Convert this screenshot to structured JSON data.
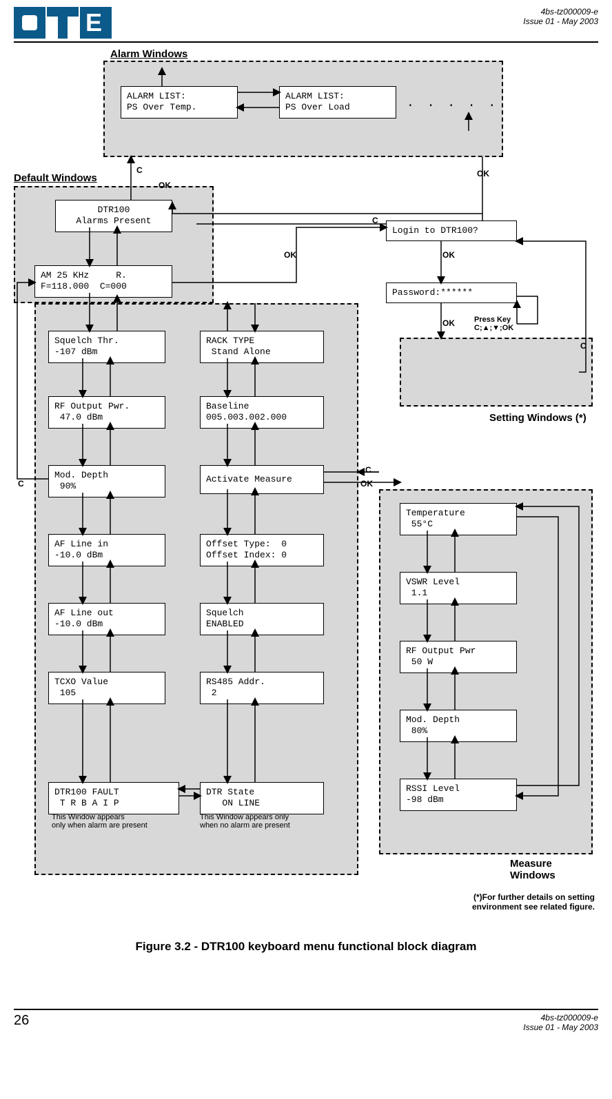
{
  "header": {
    "docref": "4bs-tz000009-e",
    "issue": "Issue 01 - May 2003"
  },
  "section_labels": {
    "alarm": "Alarm Windows",
    "default": "Default Windows",
    "setting": "Setting Windows (*)",
    "measure": "Measure Windows"
  },
  "boxes": {
    "alarm1": "ALARM LIST:\nPS Over Temp.",
    "alarm2": "ALARM LIST:\nPS Over Load",
    "dtr_alarms": "DTR100\nAlarms Present",
    "am25": "AM 25 KHz     R.\nF=118.000  C=000",
    "login": "Login to DTR100?",
    "password": "Password:******",
    "squelch_thr": "Squelch Thr.\n-107 dBm",
    "rf_out_pwr": "RF Output Pwr.\n 47.0 dBm",
    "mod_depth": "Mod. Depth\n 90%",
    "af_line_in": "AF Line in\n-10.0 dBm",
    "af_line_out": "AF Line out\n-10.0 dBm",
    "tcxo": "TCXO Value\n 105",
    "fault": "DTR100 FAULT\n T R B A I P",
    "rack_type": "RACK TYPE\n Stand Alone",
    "baseline": "Baseline\n005.003.002.000",
    "activate": "Activate Measure",
    "offset": "Offset Type:  0\nOffset Index: 0",
    "squelch_en": "Squelch\nENABLED",
    "rs485": "RS485 Addr.\n 2",
    "dtr_state": "DTR State\n   ON LINE",
    "temp": "Temperature\n 55°C",
    "vswr": "VSWR Level\n 1.1",
    "rf_out_m": "RF Output Pwr\n 50 W",
    "mod_depth_m": "Mod. Depth\n 80%",
    "rssi": "RSSI Level\n-98 dBm"
  },
  "nav": {
    "c": "C",
    "ok": "OK",
    "press_key": "Press Key",
    "press_key2": "C;▲;▼;OK"
  },
  "ellipsis": ". . . . .",
  "notes": {
    "fault_note": "This Window appears\nonly when alarm are present",
    "state_note": "This Window appears only\nwhen no alarm are present",
    "setting_footnote": "(*)For further details on setting\nenvironment see related figure."
  },
  "caption": "Figure 3.2 - DTR100 keyboard menu functional block diagram",
  "footer": {
    "page": "26",
    "docref": "4bs-tz000009-e",
    "issue": "Issue 01 - May 2003"
  }
}
